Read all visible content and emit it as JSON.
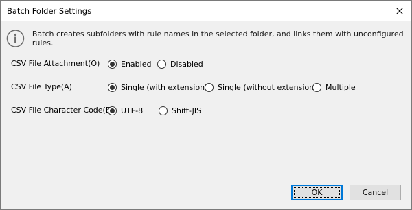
{
  "window": {
    "title": "Batch Folder Settings"
  },
  "info": {
    "icon": "info-icon",
    "text": "Batch creates subfolders with rule names in the selected folder, and links them with unconfigured rules."
  },
  "fields": {
    "csv_attachment": {
      "label": "CSV File Attachment(O)",
      "options": [
        "Enabled",
        "Disabled"
      ],
      "selected": "Enabled"
    },
    "csv_type": {
      "label": "CSV File Type(A)",
      "options": [
        "Single (with extension)",
        "Single (without extension)",
        "Multiple"
      ],
      "selected": "Single (with extension)"
    },
    "csv_encoding": {
      "label": "CSV File Character Code(E)",
      "options": [
        "UTF-8",
        "Shift-JIS"
      ],
      "selected": "UTF-8"
    }
  },
  "buttons": {
    "ok": "OK",
    "cancel": "Cancel"
  }
}
